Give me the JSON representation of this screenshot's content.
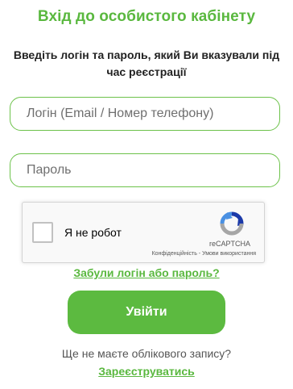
{
  "page": {
    "title": "Вхід до особистого кабінету",
    "subtitle": "Введіть логін та пароль, який Ви вказували під час реєстрації"
  },
  "form": {
    "login_placeholder": "Логін (Email / Номер телефону)",
    "login_value": "",
    "password_placeholder": "Пароль",
    "password_value": ""
  },
  "captcha": {
    "label": "Я не робот",
    "brand": "reCAPTCHA",
    "links": "Конфіденційність - Умови використання",
    "checked": false
  },
  "links": {
    "forgot": "Забули логін або пароль?",
    "no_account": "Ще не маєте облікового запису?",
    "register": "Зареєструватись"
  },
  "buttons": {
    "login": "Увійти"
  },
  "colors": {
    "accent": "#5ab83f",
    "button": "#5cba40",
    "field_border": "#6cc24a",
    "recaptcha_blue": "#1c3aa9",
    "recaptcha_light_blue": "#4a90e2",
    "recaptcha_gray": "#a6a6a6"
  },
  "icons": {
    "captcha_logo": "recaptcha-logo-icon"
  }
}
